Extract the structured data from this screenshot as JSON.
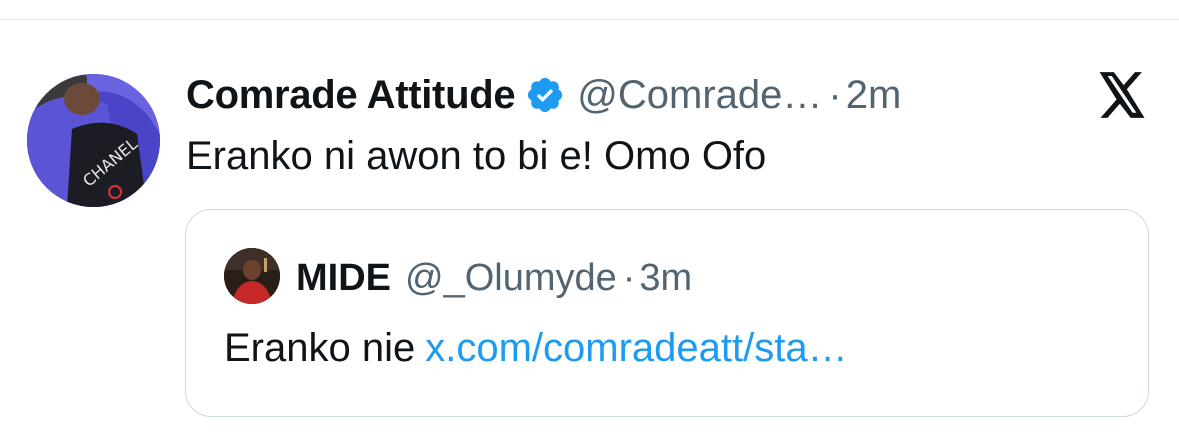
{
  "tweet": {
    "display_name": "Comrade Attitude",
    "handle": "@Comrade…",
    "separator": "·",
    "time": "2m",
    "text": "Eranko ni awon to bi e! Omo Ofo",
    "avatar_icon": "user-avatar-photo",
    "verified_icon": "verified-badge-icon",
    "platform_icon": "x-logo-icon"
  },
  "quote": {
    "display_name": "MIDE",
    "handle": "@_Olumyde",
    "separator": "·",
    "time": "3m",
    "text": "Eranko nie",
    "link_text": "x.com/comradeatt/sta…",
    "avatar_icon": "user-avatar-photo"
  },
  "colors": {
    "text_primary": "#0f1419",
    "text_secondary": "#536471",
    "link": "#1d9bf0",
    "verified": "#1d9bf0",
    "border": "#cfd9de"
  }
}
